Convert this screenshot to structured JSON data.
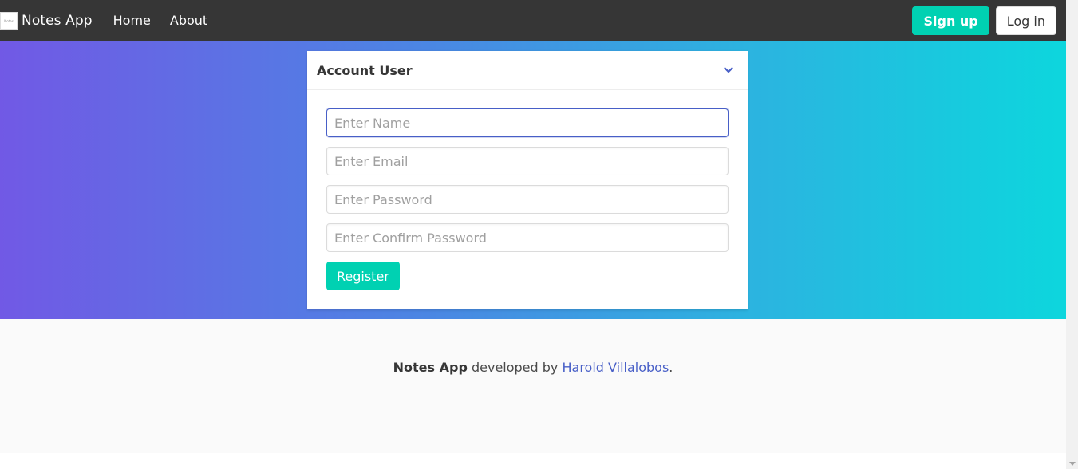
{
  "navbar": {
    "logo_text": "Notes",
    "brand": "Notes App",
    "links": [
      {
        "label": "Home"
      },
      {
        "label": "About"
      }
    ],
    "signup_label": "Sign up",
    "login_label": "Log in"
  },
  "card": {
    "title": "Account User",
    "fields": [
      {
        "placeholder": "Enter Name",
        "value": ""
      },
      {
        "placeholder": "Enter Email",
        "value": ""
      },
      {
        "placeholder": "Enter Password",
        "value": ""
      },
      {
        "placeholder": "Enter Confirm Password",
        "value": ""
      }
    ],
    "register_label": "Register"
  },
  "footer": {
    "app_name": "Notes App",
    "middle_text": " developed by ",
    "author": "Harold Villalobos",
    "end_text": "."
  },
  "colors": {
    "navbar": "#363636",
    "accent": "#00d1b2",
    "link": "#485fc7",
    "gradient_start": "#7159e5",
    "gradient_end": "#0dd6dd"
  }
}
